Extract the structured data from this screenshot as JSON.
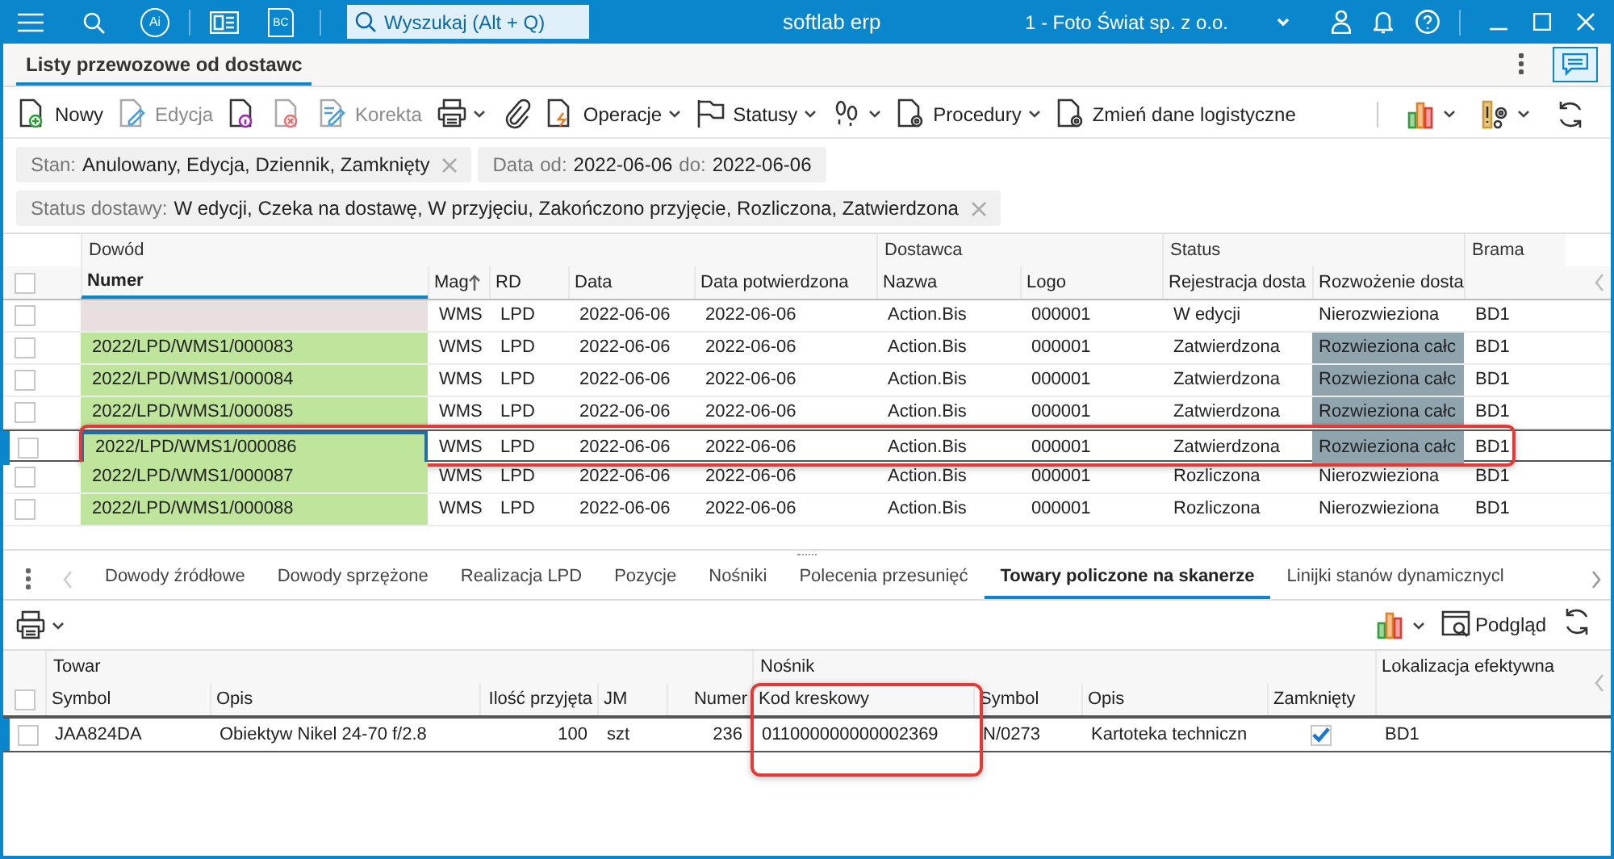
{
  "window": {
    "icon_labels": [
      "Ai",
      "BC"
    ],
    "search": {
      "placeholder": "Wyszukaj (Alt + Q)"
    },
    "title": "softlab erp",
    "company": "1 - Foto Świat sp. z o.o."
  },
  "document_tab": {
    "label": "Listy przewozowe od dostawc",
    "selected": true
  },
  "toolbar": [
    {
      "label": "Nowy",
      "disabled": false,
      "dropdown": false
    },
    {
      "label": "Edycja",
      "disabled": true,
      "dropdown": false
    },
    {
      "disabled": false,
      "dropdown": false
    },
    {
      "disabled": true,
      "dropdown": false
    },
    {
      "label": "Korekta",
      "disabled": true,
      "dropdown": false
    },
    {
      "disabled": false,
      "dropdown": true
    },
    {
      "disabled": false,
      "dropdown": false
    },
    {
      "label": "Operacje",
      "disabled": false,
      "dropdown": true
    },
    {
      "label": "Statusy",
      "disabled": false,
      "dropdown": true
    },
    {
      "disabled": false,
      "dropdown": true
    },
    {
      "label": "Procedury",
      "disabled": false,
      "dropdown": true
    },
    {
      "label": "Zmień dane logistyczne",
      "disabled": false,
      "dropdown": false
    }
  ],
  "toolbar_right": [
    {
      "dropdown": true
    },
    {
      "dropdown": true
    },
    {
      "dropdown": false
    }
  ],
  "filters": [
    [
      {
        "parts": [
          {
            "kind": "label",
            "text": "Stan:"
          },
          {
            "kind": "value",
            "text": "Anulowany, Edycja, Dziennik, Zamknięty"
          }
        ],
        "removable": true
      },
      {
        "parts": [
          {
            "kind": "label",
            "text": "Data"
          },
          {
            "kind": "label",
            "text": "od:"
          },
          {
            "kind": "value",
            "text": "2022-06-06"
          },
          {
            "kind": "label",
            "text": "do:"
          },
          {
            "kind": "value",
            "text": "2022-06-06"
          }
        ],
        "removable": false
      }
    ],
    [
      {
        "parts": [
          {
            "kind": "label",
            "text": "Status dostawy:"
          },
          {
            "kind": "value",
            "text": "W edycji, Czeka na dostawę, W przyjęciu, Zakończono przyjęcie, Rozliczona, Zatwierdzona"
          }
        ],
        "removable": true
      }
    ]
  ],
  "table": {
    "all_checked": false,
    "groups": [
      "Dowód",
      "Dostawca",
      "Status",
      "Brama"
    ],
    "columns": [
      "Numer",
      "Mag",
      "RD",
      "Data",
      "Data potwierdzona",
      "Nazwa",
      "Logo",
      "Rejestracja dosta",
      "Rozwożenie dosta"
    ],
    "rows": [
      {
        "checked": false,
        "selected": false,
        "highlighted": false,
        "cells": [
          {
            "text": "",
            "color": "#e8e0e0"
          },
          {
            "text": "WMS"
          },
          {
            "text": "LPD"
          },
          {
            "text": "2022-06-06"
          },
          {
            "text": "2022-06-06"
          },
          {
            "text": "Action.Bis"
          },
          {
            "text": "000001"
          },
          {
            "text": "W edycji"
          },
          {
            "text": "Nierozwieziona"
          },
          {
            "text": "BD1"
          }
        ]
      },
      {
        "checked": false,
        "selected": false,
        "highlighted": false,
        "cells": [
          {
            "text": "2022/LPD/WMS1/000083",
            "color": "#bfe59c"
          },
          {
            "text": "WMS"
          },
          {
            "text": "LPD"
          },
          {
            "text": "2022-06-06"
          },
          {
            "text": "2022-06-06"
          },
          {
            "text": "Action.Bis"
          },
          {
            "text": "000001"
          },
          {
            "text": "Zatwierdzona"
          },
          {
            "text": "Rozwieziona całc",
            "color": "#90a4ae"
          },
          {
            "text": "BD1"
          }
        ]
      },
      {
        "checked": false,
        "selected": false,
        "highlighted": false,
        "cells": [
          {
            "text": "2022/LPD/WMS1/000084",
            "color": "#bfe59c"
          },
          {
            "text": "WMS"
          },
          {
            "text": "LPD"
          },
          {
            "text": "2022-06-06"
          },
          {
            "text": "2022-06-06"
          },
          {
            "text": "Action.Bis"
          },
          {
            "text": "000001"
          },
          {
            "text": "Zatwierdzona"
          },
          {
            "text": "Rozwieziona całc",
            "color": "#90a4ae"
          },
          {
            "text": "BD1"
          }
        ]
      },
      {
        "checked": false,
        "selected": false,
        "highlighted": false,
        "cells": [
          {
            "text": "2022/LPD/WMS1/000085",
            "color": "#bfe59c"
          },
          {
            "text": "WMS"
          },
          {
            "text": "LPD"
          },
          {
            "text": "2022-06-06"
          },
          {
            "text": "2022-06-06"
          },
          {
            "text": "Action.Bis"
          },
          {
            "text": "000001"
          },
          {
            "text": "Zatwierdzona"
          },
          {
            "text": "Rozwieziona całc",
            "color": "#90a4ae"
          },
          {
            "text": "BD1"
          }
        ]
      },
      {
        "checked": false,
        "selected": true,
        "highlighted": true,
        "cells": [
          {
            "text": "2022/LPD/WMS1/000086",
            "color": "#bfe59c"
          },
          {
            "text": "WMS"
          },
          {
            "text": "LPD"
          },
          {
            "text": "2022-06-06"
          },
          {
            "text": "2022-06-06"
          },
          {
            "text": "Action.Bis"
          },
          {
            "text": "000001"
          },
          {
            "text": "Zatwierdzona"
          },
          {
            "text": "Rozwieziona całc",
            "color": "#90a4ae"
          },
          {
            "text": "BD1"
          }
        ]
      },
      {
        "checked": false,
        "selected": false,
        "highlighted": false,
        "cells": [
          {
            "text": "2022/LPD/WMS1/000087",
            "color": "#bfe59c"
          },
          {
            "text": "WMS"
          },
          {
            "text": "LPD"
          },
          {
            "text": "2022-06-06"
          },
          {
            "text": "2022-06-06"
          },
          {
            "text": "Action.Bis"
          },
          {
            "text": "000001"
          },
          {
            "text": "Rozliczona"
          },
          {
            "text": "Nierozwieziona"
          },
          {
            "text": "BD1"
          }
        ]
      },
      {
        "checked": false,
        "selected": false,
        "highlighted": false,
        "cells": [
          {
            "text": "2022/LPD/WMS1/000088",
            "color": "#bfe59c"
          },
          {
            "text": "WMS"
          },
          {
            "text": "LPD"
          },
          {
            "text": "2022-06-06"
          },
          {
            "text": "2022-06-06"
          },
          {
            "text": "Action.Bis"
          },
          {
            "text": "000001"
          },
          {
            "text": "Rozliczona"
          },
          {
            "text": "Nierozwieziona"
          },
          {
            "text": "BD1"
          }
        ]
      }
    ]
  },
  "detail_tabs": [
    {
      "label": "Dowody źródłowe",
      "selected": false
    },
    {
      "label": "Dowody sprzężone",
      "selected": false
    },
    {
      "label": "Realizacja LPD",
      "selected": false
    },
    {
      "label": "Pozycje",
      "selected": false
    },
    {
      "label": "Nośniki",
      "selected": false
    },
    {
      "label": "Polecenia przesunięć",
      "selected": false
    },
    {
      "label": "Towary policzone na skanerze",
      "selected": true
    },
    {
      "label": "Linijki stanów dynamicznycl",
      "selected": false
    }
  ],
  "detail_toolbar": {
    "preview_label": "Podgląd"
  },
  "detail_table": {
    "all_checked": false,
    "groups": [
      "Towar",
      "Nośnik"
    ],
    "columns": [
      {
        "label": "Symbol",
        "highlighted": false
      },
      {
        "label": "Opis",
        "highlighted": false
      },
      {
        "label": "Ilość przyjęta",
        "highlighted": false
      },
      {
        "label": "JM",
        "highlighted": false
      },
      {
        "label": "Numer",
        "highlighted": false
      },
      {
        "label": "Kod kreskowy",
        "highlighted": true
      },
      {
        "label": "Symbol",
        "highlighted": false
      },
      {
        "label": "Opis",
        "highlighted": false
      },
      {
        "label": "Zamknięty",
        "highlighted": false
      },
      {
        "label": "Lokalizacja efektywna",
        "highlighted": false
      }
    ],
    "rows": [
      {
        "checked": false,
        "symbol": "JAA824DA",
        "opis": "Obiektyw Nikel 24-70 f/2.8",
        "ilosc": "100",
        "jm": "szt",
        "numer": "236",
        "kod": "011000000000002369",
        "symbol_2": "N/0273",
        "opis_2": "Kartoteka techniczn",
        "zamkniety": true,
        "lokalizacja": "BD1"
      }
    ]
  }
}
